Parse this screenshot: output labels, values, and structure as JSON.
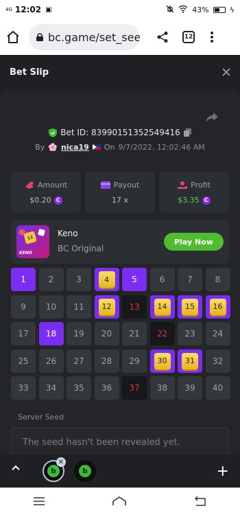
{
  "status": {
    "network": "4G",
    "time": "12:02",
    "battery": "43%"
  },
  "browser": {
    "url": "bc.game/set_seed",
    "tab_count": "12"
  },
  "modal": {
    "title": "Bet Slip"
  },
  "bet": {
    "id_label": "Bet ID: 83990151352549416",
    "by_label": "By",
    "user": "nica19",
    "on_label": "On",
    "date": "9/7/2022, 12:02:46 AM"
  },
  "stats": {
    "amount_label": "Amount",
    "amount_value": "$0.20",
    "payout_label": "Payout",
    "payout_value": "17 x",
    "profit_label": "Profit",
    "profit_value": "$3.35"
  },
  "game": {
    "name": "Keno",
    "subtitle": "BC Original",
    "play_label": "Play Now",
    "thumb_number": "12",
    "thumb_label": "KENO"
  },
  "keno": {
    "picked_only": [
      1,
      5,
      18
    ],
    "hits": [
      4,
      12,
      14,
      15,
      16,
      30,
      31
    ],
    "drawn_miss": [
      13,
      22,
      37
    ]
  },
  "seed": {
    "label": "Server Seed",
    "value": "The seed hasn't been revealed yet."
  },
  "colors": {
    "accent_purple": "#7b2df4",
    "play_green": "#4ebd2f",
    "profit_green": "#5fd23f",
    "miss_red": "#e0333d",
    "hit_gold": "#f4c63b"
  }
}
